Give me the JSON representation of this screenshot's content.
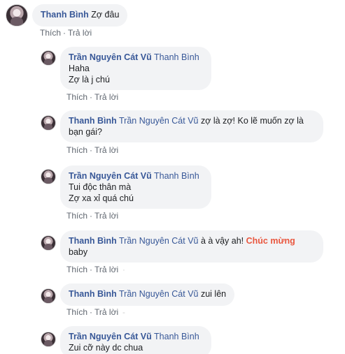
{
  "actions": {
    "like": "Thích",
    "reply": "Trả lời",
    "sep": "·"
  },
  "c1": {
    "author": "Thanh Bình",
    "text": "Zợ đâu"
  },
  "c2": {
    "author": "Trần Nguyên Cát Vũ",
    "mention": "Thanh Bình",
    "line1": "Haha",
    "line2": "Zợ là j chú"
  },
  "c3": {
    "author": "Thanh Bình",
    "mention": "Trần Nguyên Cát Vũ",
    "line1": "zợ là zợ! Ko lẽ muốn zợ là",
    "line2": "bạn gái?"
  },
  "c4": {
    "author": "Trần Nguyên Cát Vũ",
    "mention": "Thanh Bình",
    "line1": "Tui độc thân mà",
    "line2": "Zợ xa xỉ quá chú"
  },
  "c5": {
    "author": "Thanh Bình",
    "mention": "Trần Nguyên Cát Vũ",
    "text_a": "à à vậy ah!",
    "highlight": "Chúc mừng",
    "line2": "baby"
  },
  "c6": {
    "author": "Thanh Bình",
    "mention": "Trần Nguyên Cát Vũ",
    "text": "zui lên"
  },
  "c7": {
    "author": "Trần Nguyên Cát Vũ",
    "mention": "Thanh Bình",
    "line1": "Zui cỡ này dc chua"
  },
  "colors": {
    "link": "#385898",
    "highlight": "#e9573f",
    "bubble": "#f2f3f5",
    "meta": "#606770"
  }
}
